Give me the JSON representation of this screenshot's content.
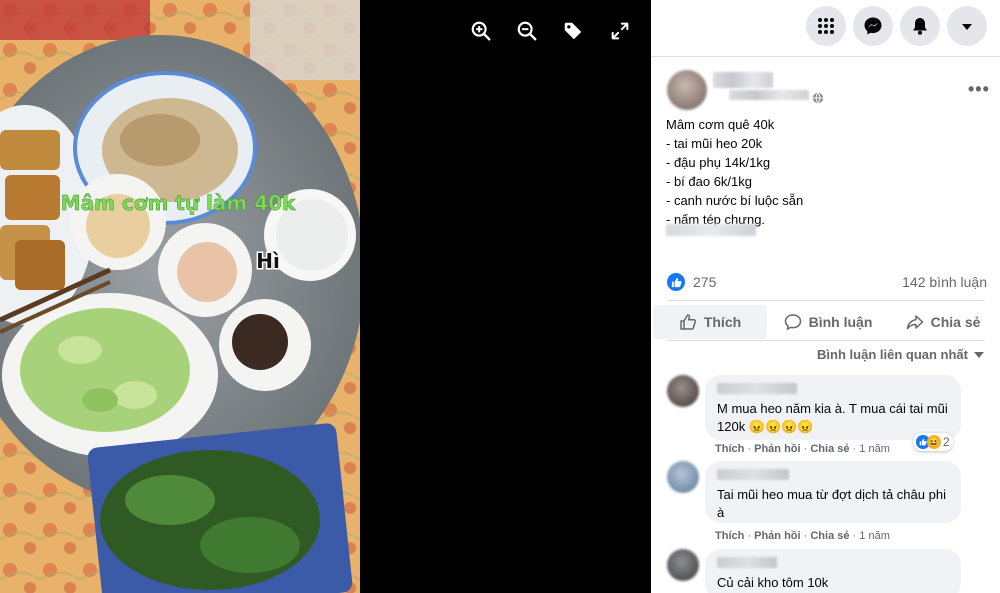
{
  "viewer": {
    "overlay_text": "Mâm cơm tự làm 40k",
    "overlay_sticker": "Hì",
    "toolbar": [
      {
        "icon": "zoom-in-icon"
      },
      {
        "icon": "zoom-out-icon"
      },
      {
        "icon": "tag-icon"
      },
      {
        "icon": "fullscreen-icon"
      }
    ]
  },
  "topbar": {
    "icons": [
      "menu-grid-icon",
      "messenger-icon",
      "notifications-bell-icon",
      "account-dropdown-icon"
    ]
  },
  "post": {
    "lines": [
      "Mâm cơm quê 40k",
      "- tai mũi heo 20k",
      "- đậu phụ 14k/1kg",
      "- bí đao 6k/1kg",
      "- canh nước bí luộc sẵn",
      "- nấm tép chưng."
    ],
    "reaction_count": "275",
    "comment_count": "142 bình luận"
  },
  "actions": {
    "like": "Thích",
    "comment": "Bình luận",
    "share": "Chia sẻ"
  },
  "sort_label": "Bình luận liên quan nhất",
  "comments": [
    {
      "text": "M mua heo năm kia à. T mua cái tai mũi 120k 😠😠😠😠",
      "reply_label": "Thích",
      "reply2": "Phản hồi",
      "share": "Chia sẻ",
      "time": "1 năm",
      "reactions": "2"
    },
    {
      "text": "Tai mũi heo mua từ đợt dịch tả châu phi à",
      "reply_label": "Thích",
      "reply2": "Phản hồi",
      "share": "Chia sẻ",
      "time": "1 năm"
    },
    {
      "text": "Củ cải kho tôm 10k"
    }
  ],
  "colors": {
    "facebook_blue": "#1877f2",
    "panel_bg": "#ffffff",
    "bubble_bg": "#f0f2f5",
    "secondary_text": "#65676b"
  }
}
